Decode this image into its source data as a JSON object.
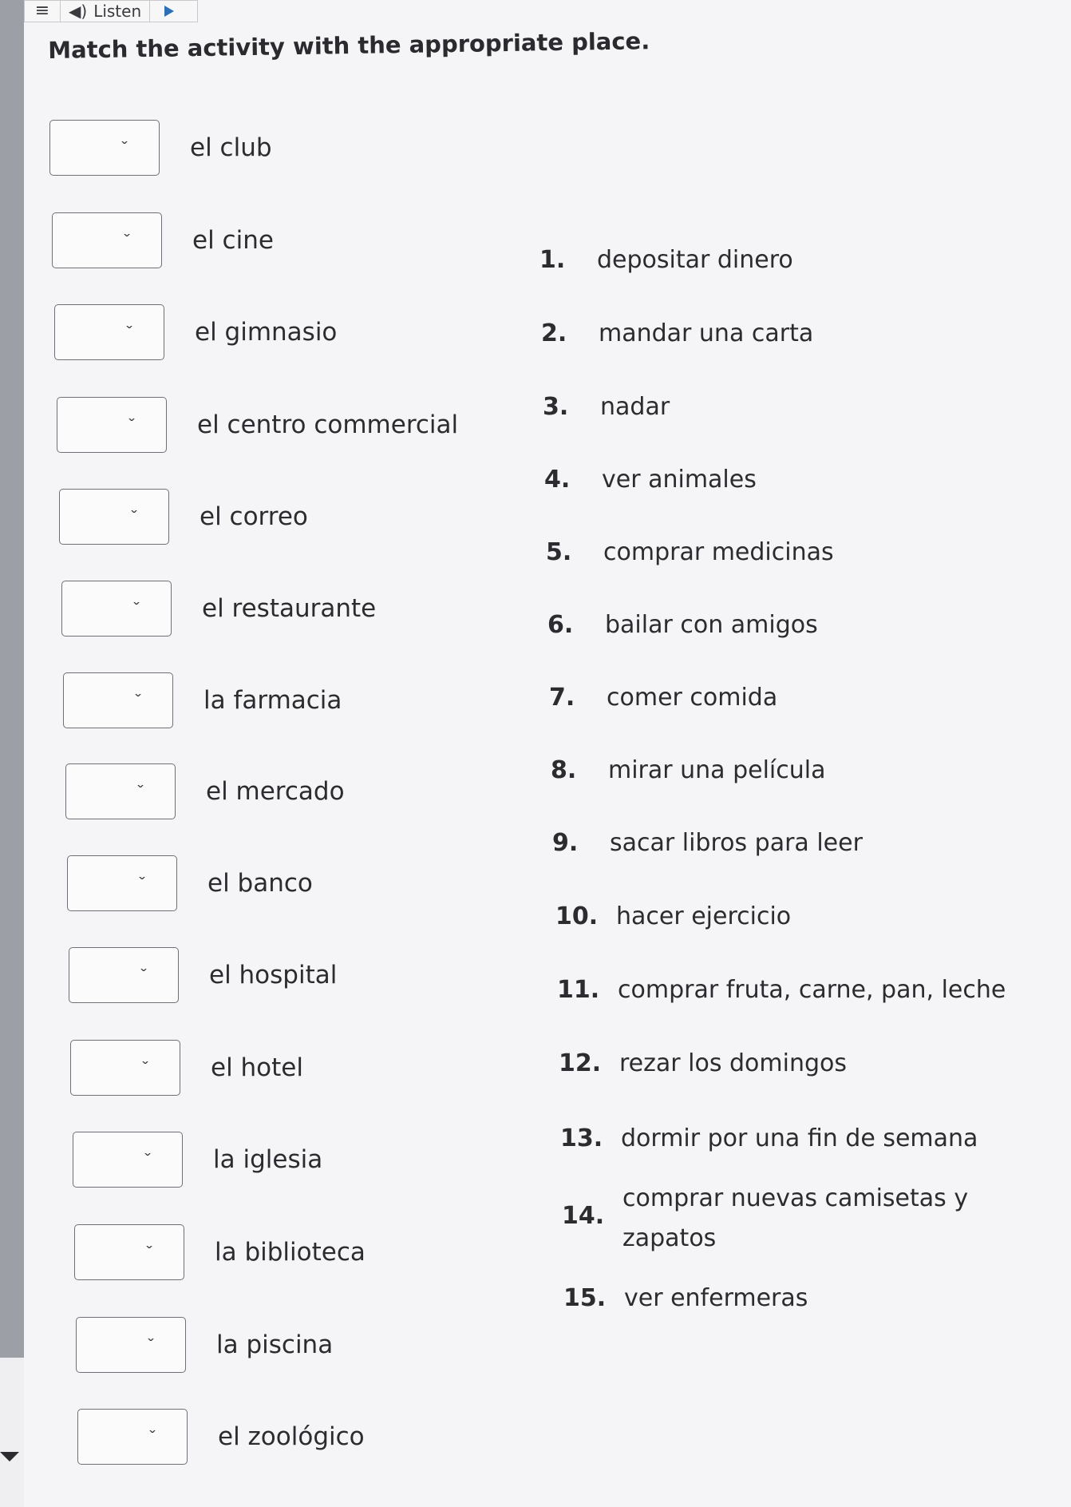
{
  "toolbar": {
    "menu_icon": "hamburger-icon",
    "listen_label": "Listen",
    "speaker_icon": "speaker-icon",
    "play_icon": "play-icon"
  },
  "instruction": "Match the activity with the appropriate place.",
  "places": [
    {
      "label": "el club",
      "selected": ""
    },
    {
      "label": "el cine",
      "selected": ""
    },
    {
      "label": "el gimnasio",
      "selected": ""
    },
    {
      "label": "el centro commercial",
      "selected": ""
    },
    {
      "label": "el correo",
      "selected": ""
    },
    {
      "label": "el restaurante",
      "selected": ""
    },
    {
      "label": "la farmacia",
      "selected": ""
    },
    {
      "label": "el mercado",
      "selected": ""
    },
    {
      "label": "el banco",
      "selected": ""
    },
    {
      "label": "el hospital",
      "selected": ""
    },
    {
      "label": "el hotel",
      "selected": ""
    },
    {
      "label": "la iglesia",
      "selected": ""
    },
    {
      "label": "la biblioteca",
      "selected": ""
    },
    {
      "label": "la piscina",
      "selected": ""
    },
    {
      "label": "el zoológico",
      "selected": ""
    }
  ],
  "activities": [
    {
      "num": "1.",
      "text": "depositar dinero"
    },
    {
      "num": "2.",
      "text": "mandar una carta"
    },
    {
      "num": "3.",
      "text": "nadar"
    },
    {
      "num": "4.",
      "text": "ver animales"
    },
    {
      "num": "5.",
      "text": "comprar medicinas"
    },
    {
      "num": "6.",
      "text": "bailar con amigos"
    },
    {
      "num": "7.",
      "text": "comer comida"
    },
    {
      "num": "8.",
      "text": "mirar una película"
    },
    {
      "num": "9.",
      "text": "sacar libros para leer"
    },
    {
      "num": "10.",
      "text": "hacer ejercicio"
    },
    {
      "num": "11.",
      "text": "comprar fruta, carne, pan, leche"
    },
    {
      "num": "12.",
      "text": "rezar los domingos"
    },
    {
      "num": "13.",
      "text": "dormir por una fin de semana"
    },
    {
      "num": "14.",
      "text_line1": "comprar nuevas camisetas y",
      "text_line2": "zapatos"
    },
    {
      "num": "15.",
      "text": "ver enfermeras"
    }
  ]
}
